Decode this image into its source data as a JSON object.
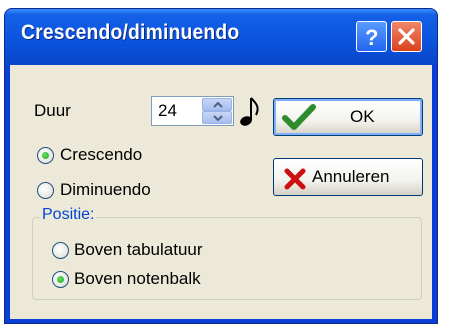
{
  "window": {
    "title": "Crescendo/diminuendo",
    "help_icon": "help-question-icon",
    "close_icon": "close-x-icon"
  },
  "duration": {
    "label": "Duur",
    "value": "24",
    "note_icon": "eighth-note-icon"
  },
  "type_options": [
    {
      "label": "Crescendo",
      "selected": true
    },
    {
      "label": "Diminuendo",
      "selected": false
    }
  ],
  "buttons": {
    "ok_label": "OK",
    "ok_icon": "checkmark-icon",
    "cancel_label": "Annuleren",
    "cancel_icon": "red-x-icon"
  },
  "position_group": {
    "title": "Positie:",
    "options": [
      {
        "label": "Boven tabulatuur",
        "selected": false
      },
      {
        "label": "Boven notenbalk",
        "selected": true
      }
    ]
  },
  "colors": {
    "titlebar": "#0a47c9",
    "dialog_bg": "#ece9d8",
    "group_title": "#0046d5",
    "checkmark": "#2e8b2e",
    "cancel_x": "#cc1111"
  }
}
